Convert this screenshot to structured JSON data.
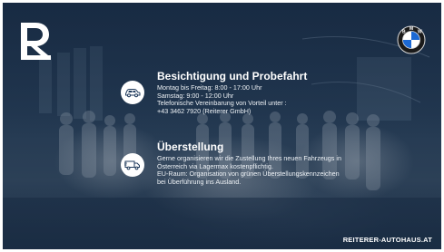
{
  "brand": {
    "logo_icon": "reiterer-r-logo",
    "partner_icon": "bmw-logo"
  },
  "sections": [
    {
      "icon": "car-icon",
      "title": "Besichtigung und Probefahrt",
      "lines": [
        "Montag bis Freitag:  8:00 - 17:00 Uhr",
        "Samstag: 9:00 - 12:00 Uhr",
        "Telefonische Vereinbarung von Vorteil unter :",
        "+43 3462 7920  (Reiterer GmbH)"
      ]
    },
    {
      "icon": "truck-icon",
      "title": "Überstellung",
      "lines": [
        "Gerne organisieren wir die Zustellung Ihres neuen Fahrzeugs in",
        "Österreich via Lagermax kostenpflichtig.",
        "EU-Raum: Organisation von grünen Überstellungskennzeichen",
        "bei Überführung ins Ausland."
      ]
    }
  ],
  "footer": {
    "website": "REITERER-AUTOHAUS.AT"
  },
  "colors": {
    "background": "#22364d",
    "text": "#ffffff",
    "icon_fill": "#1f3a5c",
    "bmw_blue": "#1c69d4"
  }
}
